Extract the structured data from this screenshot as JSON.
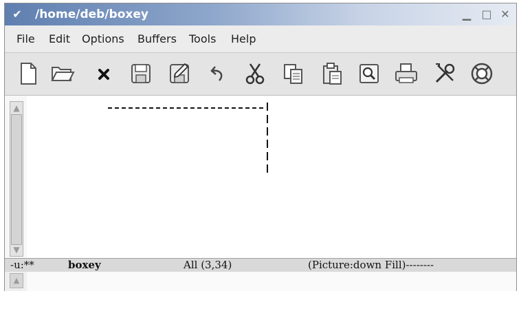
{
  "window": {
    "title": "/home/deb/boxey",
    "menu_glyph": "✔",
    "minimize_glyph": "▁",
    "maximize_glyph": "□",
    "close_glyph": "✕"
  },
  "menubar": {
    "items": [
      "File",
      "Edit",
      "Options",
      "Buffers",
      "Tools",
      "Help"
    ]
  },
  "toolbar": {
    "icons": [
      "new-file-icon",
      "open-folder-icon",
      "close-buffer-icon",
      "save-icon",
      "save-as-icon",
      "undo-icon",
      "cut-icon",
      "copy-icon",
      "paste-icon",
      "search-icon",
      "print-icon",
      "customize-icon",
      "help-icon"
    ]
  },
  "modeline": {
    "status": "-u:**",
    "buffer": "boxey",
    "position": "All (3,34)",
    "modes": "(Picture:down Fill)--------"
  },
  "colors": {
    "titlebar_start": "#5f7fb0",
    "text": "#202020"
  }
}
